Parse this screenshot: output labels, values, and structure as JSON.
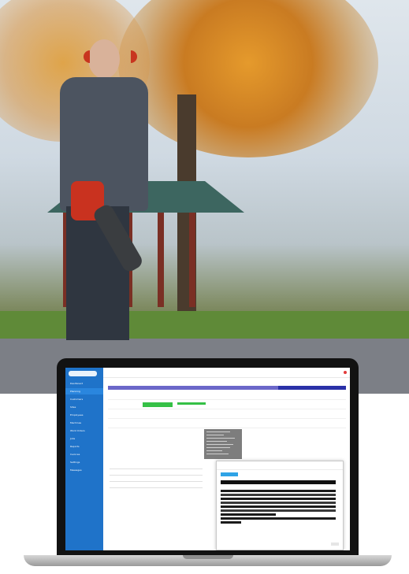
{
  "photo": {
    "description_icon": "photo-icon",
    "bg": "#b9c4c9"
  },
  "laptop": {
    "sidebar_items": [
      {
        "label": "Dashboard"
      },
      {
        "label": "Planning"
      },
      {
        "label": "Customers"
      },
      {
        "label": "Sites"
      },
      {
        "label": "Employees"
      },
      {
        "label": "Machines"
      },
      {
        "label": "Work Orders"
      },
      {
        "label": "Jobs"
      },
      {
        "label": "Reports"
      },
      {
        "label": "Invoices"
      },
      {
        "label": "Settings"
      },
      {
        "label": "Messages"
      }
    ],
    "colors": {
      "sidebar": "#1f73c9",
      "week_header": "#6b67c9",
      "event": "#35c046",
      "modal_button": "#2fa3e6"
    }
  }
}
